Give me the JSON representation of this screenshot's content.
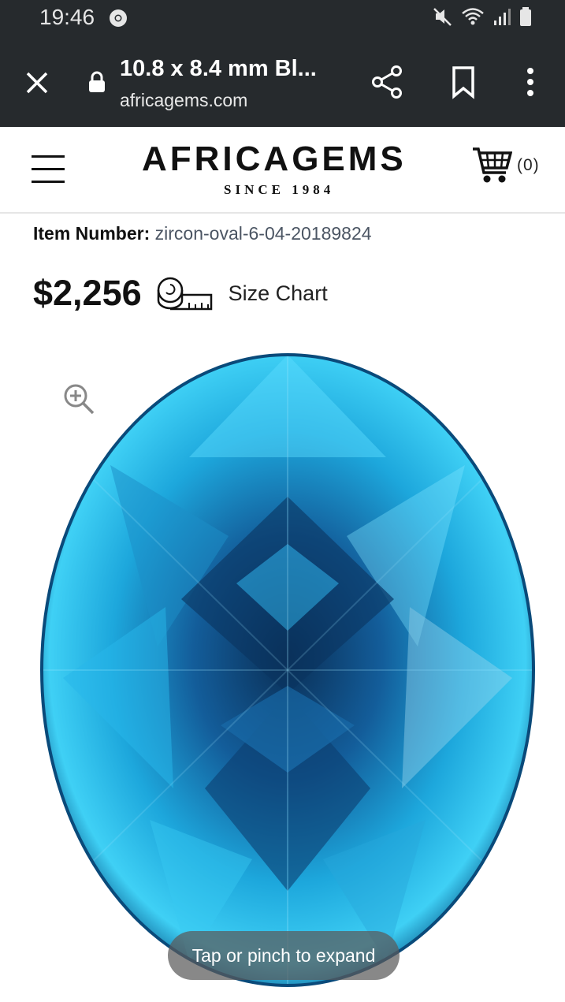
{
  "status_bar": {
    "time": "19:46",
    "icons": [
      "chrome-icon",
      "mute-icon",
      "wifi-icon",
      "signal-icon",
      "battery-icon"
    ]
  },
  "browser": {
    "title": "10.8 x 8.4 mm Bl...",
    "domain": "africagems.com",
    "icons": [
      "close-icon",
      "lock-icon",
      "share-icon",
      "bookmark-icon",
      "more-vert-icon"
    ]
  },
  "header": {
    "brand": "AFRICAGEMS",
    "since": "SINCE 1984",
    "cart_count": "(0)"
  },
  "product": {
    "item_label": "Item Number:",
    "item_value": "zircon-oval-6-04-20189824",
    "price": "$2,256",
    "size_chart_label": "Size Chart"
  },
  "gallery": {
    "toast": "Tap or pinch to expand"
  },
  "colors": {
    "browser_bar": "#262a2d",
    "gem_light": "#3fd0f5",
    "gem_dark": "#0b3a66"
  }
}
